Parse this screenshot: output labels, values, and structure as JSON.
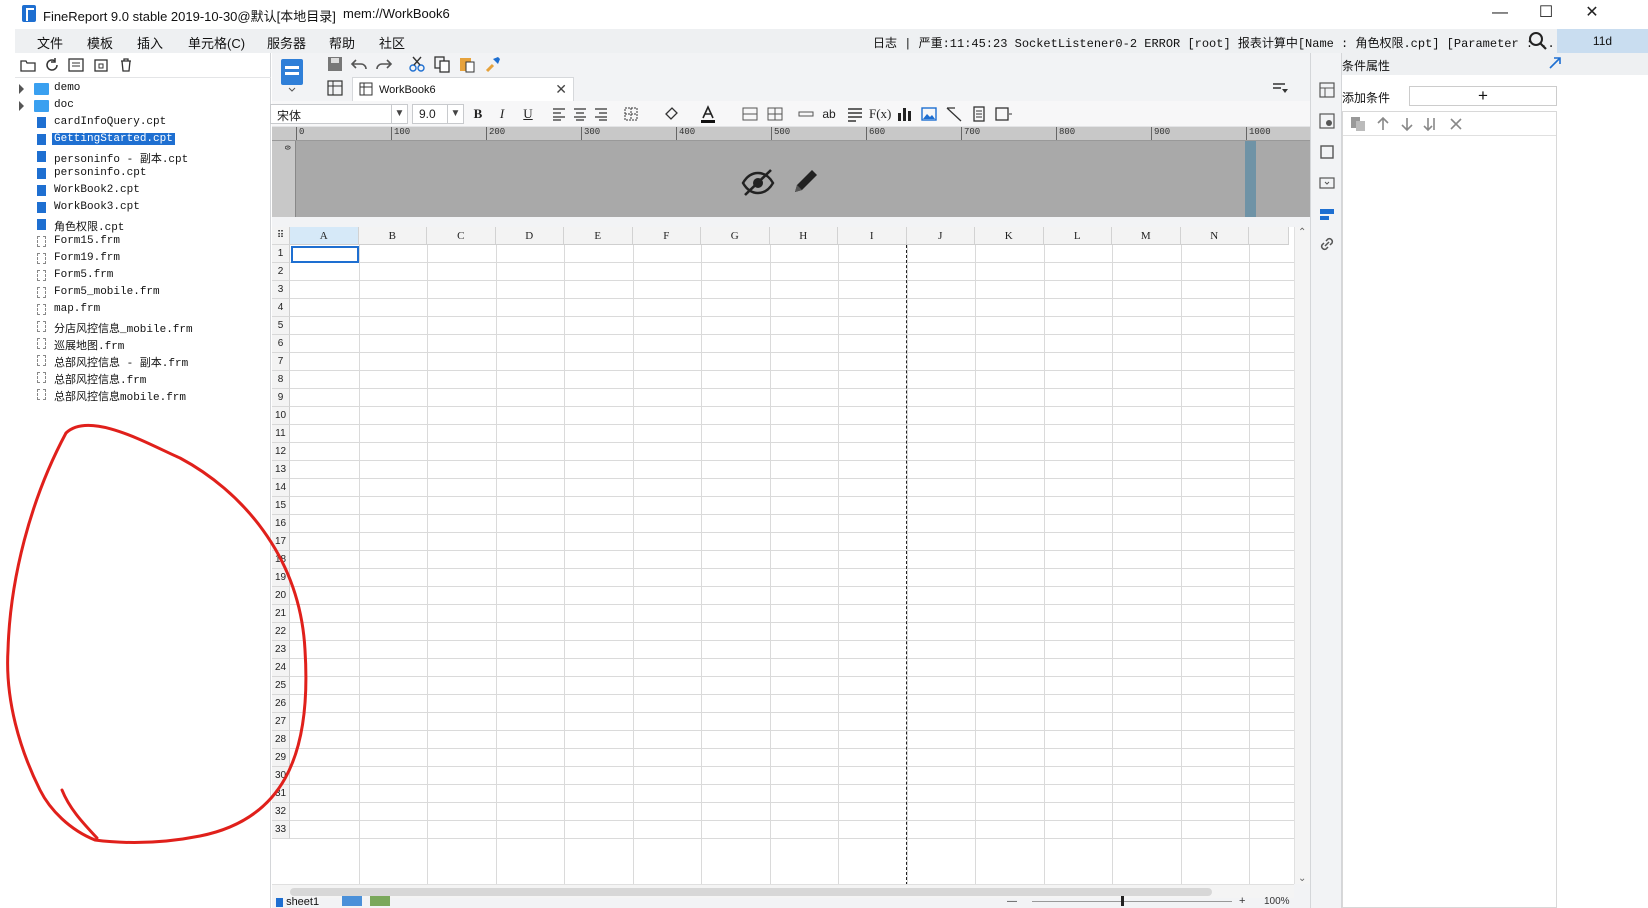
{
  "window": {
    "title": "FineReport 9.0 stable 2019-10-30@默认[本地目录]",
    "path": "mem://WorkBook6",
    "minimize": "—",
    "maximize": "☐",
    "close": "✕"
  },
  "menu": {
    "items": [
      "文件",
      "模板",
      "插入",
      "单元格(C)",
      "服务器",
      "帮助",
      "社区"
    ],
    "log_text": "日志 | 严重:11:45:23 SocketListener0-2 ERROR [root] 报表计算中[Name : 角色权限.cpt] [Parameter : ...",
    "user": "11d"
  },
  "file_tree": {
    "folders": [
      "demo",
      "doc"
    ],
    "files": [
      {
        "name": "cardInfoQuery.cpt",
        "type": "cpt"
      },
      {
        "name": "GettingStarted.cpt",
        "type": "cpt",
        "selected": true
      },
      {
        "name": "personinfo - 副本.cpt",
        "type": "cpt"
      },
      {
        "name": "personinfo.cpt",
        "type": "cpt"
      },
      {
        "name": "WorkBook2.cpt",
        "type": "cpt"
      },
      {
        "name": "WorkBook3.cpt",
        "type": "cpt"
      },
      {
        "name": "角色权限.cpt",
        "type": "cpt"
      },
      {
        "name": "Form15.frm",
        "type": "frm"
      },
      {
        "name": "Form19.frm",
        "type": "frm"
      },
      {
        "name": "Form5.frm",
        "type": "frm"
      },
      {
        "name": "Form5_mobile.frm",
        "type": "frm"
      },
      {
        "name": "map.frm",
        "type": "frm"
      },
      {
        "name": "分店风控信息_mobile.frm",
        "type": "frm"
      },
      {
        "name": "巡展地图.frm",
        "type": "frm"
      },
      {
        "name": "总部风控信息 - 副本.frm",
        "type": "frm"
      },
      {
        "name": "总部风控信息.frm",
        "type": "frm"
      },
      {
        "name": "总部风控信息mobile.frm",
        "type": "frm"
      }
    ]
  },
  "editor": {
    "tab_label": "WorkBook6",
    "tab_close": "✕",
    "font_name": "宋体",
    "font_size": "9.0",
    "ruler_ticks": [
      "0",
      "100",
      "200",
      "300",
      "400",
      "500",
      "600",
      "700",
      "800",
      "900",
      "1000"
    ],
    "vruler_tick": "0",
    "columns": [
      "A",
      "B",
      "C",
      "D",
      "E",
      "F",
      "G",
      "H",
      "I",
      "J",
      "K",
      "L",
      "M",
      "N"
    ],
    "rows": [
      "1",
      "2",
      "3",
      "4",
      "5",
      "6",
      "7",
      "8",
      "9",
      "10",
      "11",
      "12",
      "13",
      "14",
      "15",
      "16",
      "17",
      "18",
      "19",
      "20",
      "21",
      "22",
      "23",
      "24",
      "25",
      "26",
      "27",
      "28",
      "29",
      "30",
      "31",
      "32",
      "33"
    ],
    "sheet_tab": "sheet1",
    "zoom": "100%"
  },
  "right_panel": {
    "title": "条件属性",
    "add_condition_label": "添加条件",
    "add_button": "+"
  },
  "colors": {
    "accent": "#1e6fd1",
    "annotation": "#e0201b",
    "user_bg": "#c9ddf0"
  },
  "icons": {
    "search": "search-icon",
    "folder": "folder-icon",
    "cpt": "cpt-file-icon",
    "frm": "frm-file-icon"
  }
}
